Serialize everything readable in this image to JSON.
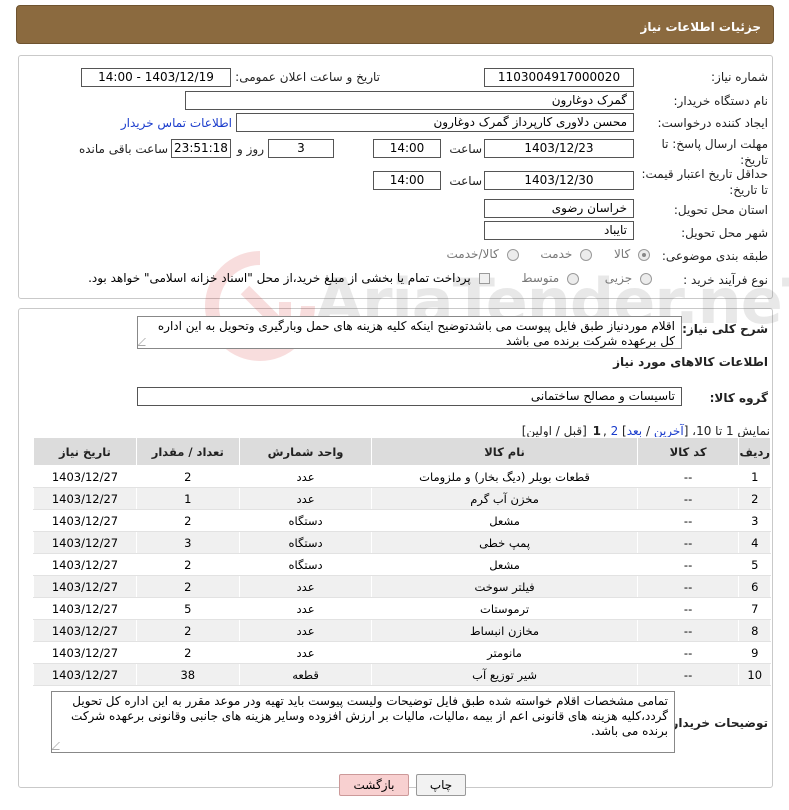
{
  "header": {
    "title": "جزئیات اطلاعات نیاز"
  },
  "fields": {
    "need_number_label": "شماره نیاز:",
    "need_number": "1103004917000020",
    "announce_label": "تاریخ و ساعت اعلان عمومی:",
    "announce_value": "1403/12/19 - 14:00",
    "buyer_org_label": "نام دستگاه خریدار:",
    "buyer_org": "گمرک دوغارون",
    "requester_label": "ایجاد کننده درخواست:",
    "requester": "محسن دلاوری کارپرداز گمرک دوغارون",
    "contact_link": "اطلاعات تماس خریدار",
    "send_deadline_label": "مهلت ارسال پاسخ: تا تاریخ:",
    "send_date": "1403/12/23",
    "hour_label": "ساعت",
    "send_hour": "14:00",
    "days_value": "3",
    "days_label": "روز و",
    "remaining_time": "23:51:18",
    "remaining_label": "ساعت باقی مانده",
    "validity_label": "حداقل تاریخ اعتبار قیمت: تا تاریخ:",
    "validity_date": "1403/12/30",
    "validity_hour": "14:00",
    "province_label": "استان محل تحویل:",
    "province": "خراسان رضوی",
    "city_label": "شهر محل تحویل:",
    "city": "تایباد",
    "category_label": "طبقه بندی موضوعی:",
    "category_options": [
      "کالا",
      "خدمت",
      "کالا/خدمت"
    ],
    "process_label": "نوع فرآیند خرید :",
    "process_options": [
      "جزیی",
      "متوسط"
    ],
    "payment_note": "پرداخت تمام یا بخشی از مبلغ خرید،از محل \"اسناد خزانه اسلامی\" خواهد بود."
  },
  "summary": {
    "label": "شرح کلی نیاز:",
    "text": "اقلام موردنیاز طبق فایل پیوست  می باشدتوضیح اینکه کلیه هزینه های حمل وبارگیری وتحویل به این اداره کل برعهده شرکت برنده می باشد"
  },
  "goods": {
    "section_title": "اطلاعات کالاهای مورد نیاز",
    "group_label": "گروه کالا:",
    "group_value": "تاسیسات و مصالح ساختمانی",
    "pagination": {
      "prefix": "نمایش 1 تا 10، [",
      "last": "آخرین",
      "sep1": " / ",
      "next": "بعد",
      "sep2": "] ",
      "page2": "2",
      "comma": " ,",
      "page1": "1",
      "suffix": " [قبل / اولین]"
    },
    "columns": [
      "ردیف",
      "کد کالا",
      "نام کالا",
      "واحد شمارش",
      "تعداد / مقدار",
      "تاریخ نیاز"
    ],
    "rows": [
      [
        "1",
        "--",
        "قطعات بویلر (دیگ بخار) و ملزومات",
        "عدد",
        "2",
        "1403/12/27"
      ],
      [
        "2",
        "--",
        "مخزن آب گرم",
        "عدد",
        "1",
        "1403/12/27"
      ],
      [
        "3",
        "--",
        "مشعل",
        "دستگاه",
        "2",
        "1403/12/27"
      ],
      [
        "4",
        "--",
        "پمپ خطی",
        "دستگاه",
        "3",
        "1403/12/27"
      ],
      [
        "5",
        "--",
        "مشعل",
        "دستگاه",
        "2",
        "1403/12/27"
      ],
      [
        "6",
        "--",
        "فیلتر سوخت",
        "عدد",
        "2",
        "1403/12/27"
      ],
      [
        "7",
        "--",
        "ترموستات",
        "عدد",
        "5",
        "1403/12/27"
      ],
      [
        "8",
        "--",
        "مخازن انبساط",
        "عدد",
        "2",
        "1403/12/27"
      ],
      [
        "9",
        "--",
        "مانومتر",
        "عدد",
        "2",
        "1403/12/27"
      ],
      [
        "10",
        "--",
        "شیر توزیع آب",
        "قطعه",
        "38",
        "1403/12/27"
      ]
    ]
  },
  "buyer_notes": {
    "label": "توضیحات خریدار:",
    "text": "تمامی  مشخصات اقلام خواسته شده طبق فایل توضیحات ولیست پیوست باید تهیه ودر موعد مقرر به این اداره کل تحویل گردد،کلیه هزینه های قانونی اعم از بیمه ،مالیات، مالیات بر ارزش افزوده وسایر هزینه های جانبی وقانونی برعهده شرکت برنده می باشد."
  },
  "buttons": {
    "print": "چاپ",
    "back": "بازگشت"
  },
  "watermark": "AriaTender.neT"
}
